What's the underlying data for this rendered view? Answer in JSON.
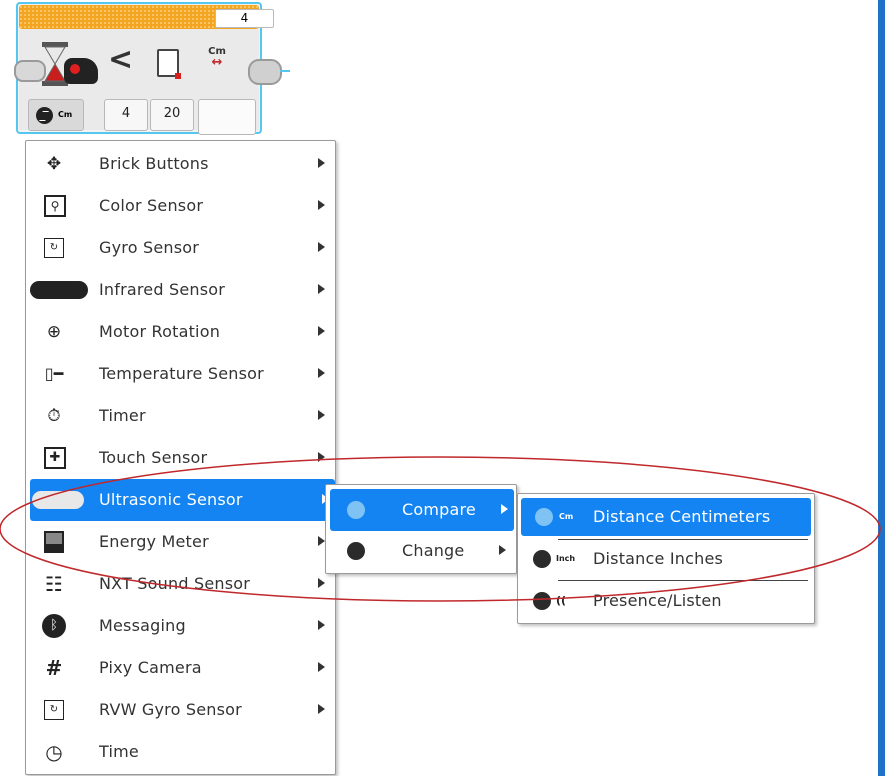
{
  "block": {
    "loop_count": "4",
    "inputs": [
      "4",
      "20"
    ],
    "unit": "Cm",
    "comparison": "<"
  },
  "menu": {
    "items": [
      {
        "label": "Brick Buttons",
        "icon": "brick-buttons-icon"
      },
      {
        "label": "Color Sensor",
        "icon": "color-sensor-icon"
      },
      {
        "label": "Gyro Sensor",
        "icon": "gyro-sensor-icon"
      },
      {
        "label": "Infrared Sensor",
        "icon": "infrared-sensor-icon"
      },
      {
        "label": "Motor Rotation",
        "icon": "motor-rotation-icon"
      },
      {
        "label": "Temperature Sensor",
        "icon": "temperature-sensor-icon"
      },
      {
        "label": "Timer",
        "icon": "timer-icon"
      },
      {
        "label": "Touch Sensor",
        "icon": "touch-sensor-icon"
      },
      {
        "label": "Ultrasonic Sensor",
        "icon": "ultrasonic-sensor-icon"
      },
      {
        "label": "Energy Meter",
        "icon": "energy-meter-icon"
      },
      {
        "label": "NXT Sound Sensor",
        "icon": "sound-sensor-icon"
      },
      {
        "label": "Messaging",
        "icon": "bluetooth-icon"
      },
      {
        "label": "Pixy Camera",
        "icon": "hash-icon"
      },
      {
        "label": "RVW Gyro Sensor",
        "icon": "gyro-sensor-icon"
      },
      {
        "label": "Time",
        "icon": "clock-icon"
      }
    ],
    "selected": "Ultrasonic Sensor"
  },
  "submenu": {
    "items": [
      {
        "label": "Compare",
        "icon": "compare-icon"
      },
      {
        "label": "Change",
        "icon": "change-icon"
      }
    ],
    "selected": "Compare"
  },
  "modes": {
    "items": [
      {
        "label": "Distance Centimeters",
        "tag": "Cm"
      },
      {
        "label": "Distance Inches",
        "tag": "Inch"
      },
      {
        "label": "Presence/Listen",
        "tag": "(("
      }
    ],
    "selected": "Distance Centimeters"
  },
  "colors": {
    "selection": "#1384f2",
    "annotation": "#c0282b",
    "block_header": "#f3a521",
    "block_border": "#55c6ee"
  }
}
